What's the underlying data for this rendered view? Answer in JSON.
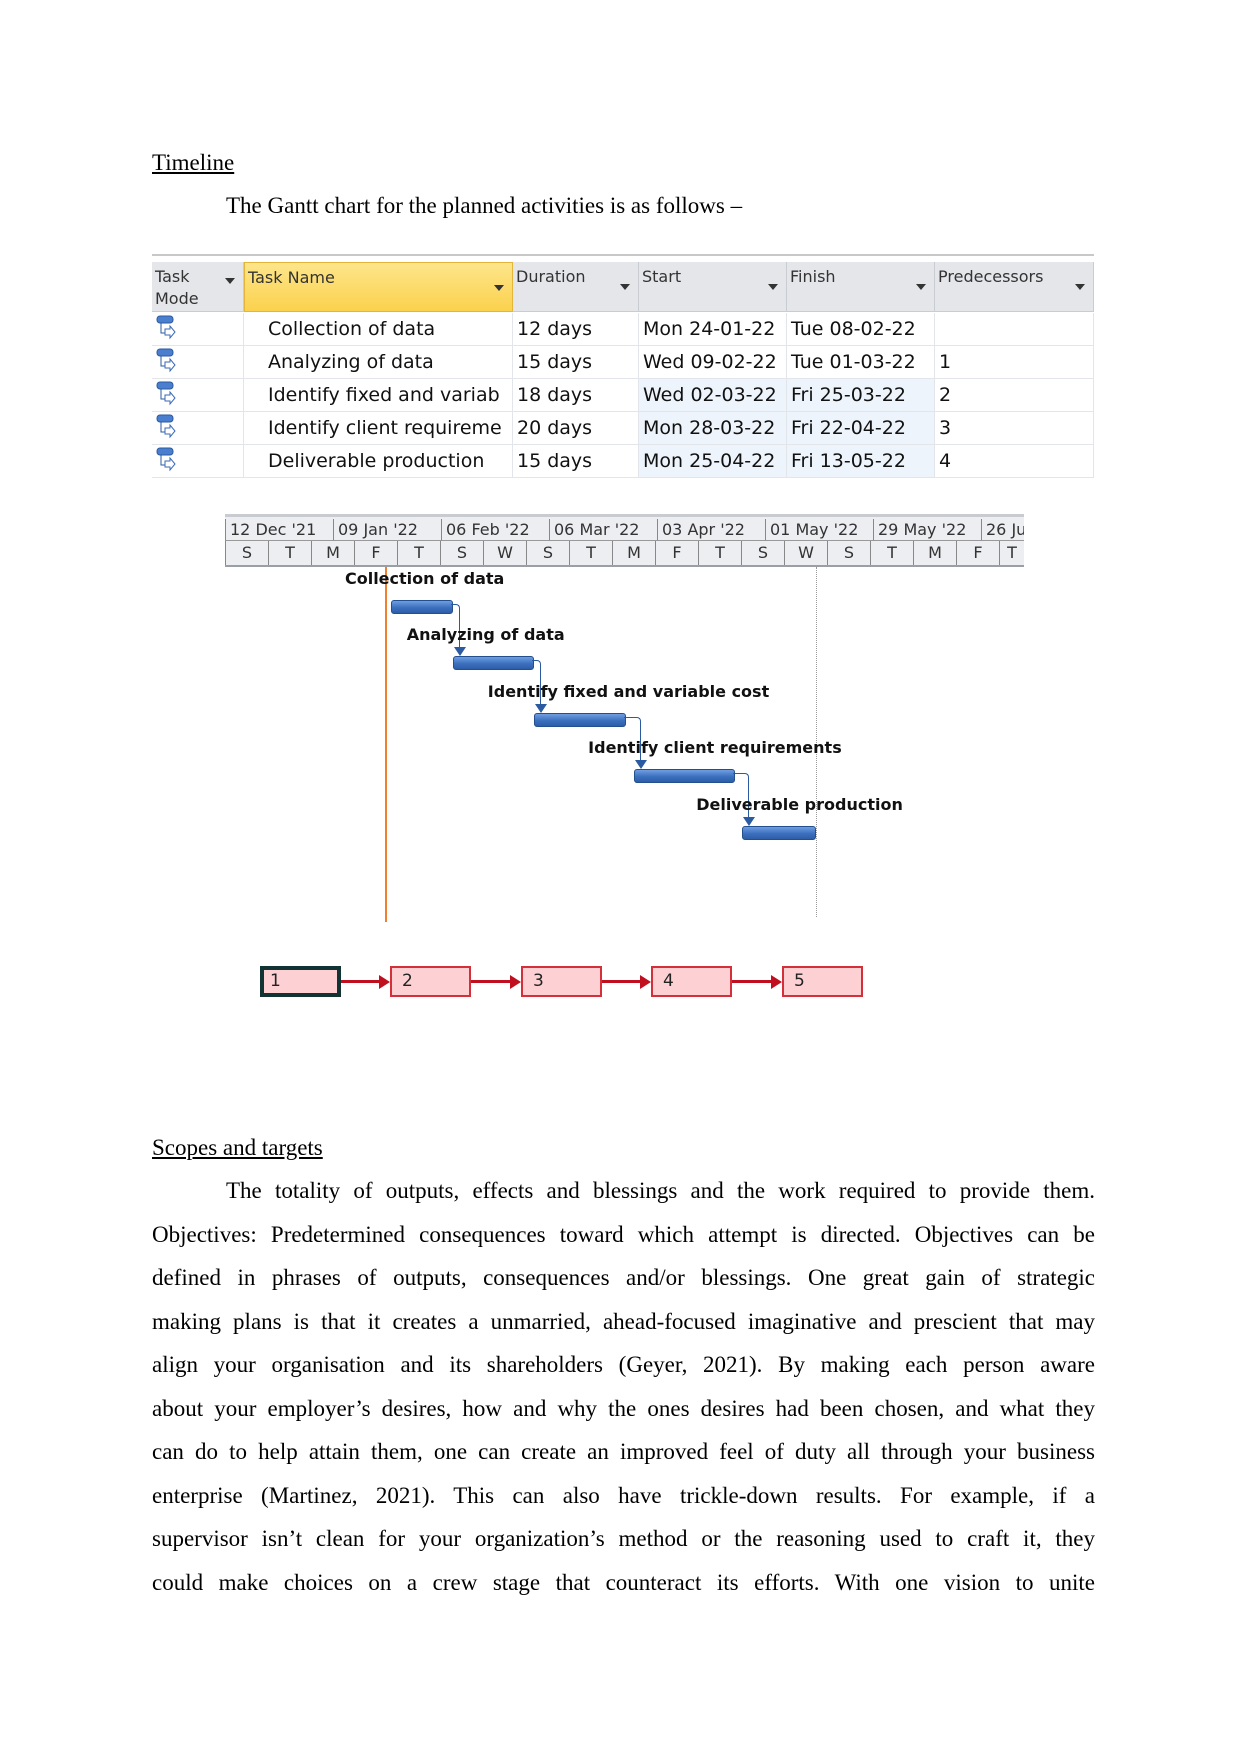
{
  "timeline": {
    "heading": "Timeline",
    "intro": "The Gantt chart for the planned activities is as follows –"
  },
  "table": {
    "headers": [
      "Task Mode",
      "Task Name",
      "Duration",
      "Start",
      "Finish",
      "Predecessors"
    ],
    "header_mode_lines": [
      "Task",
      "Mode"
    ],
    "task_mode_icon": "auto-scheduled-task-icon",
    "rows": [
      {
        "name": "Collection of data",
        "duration": "12 days",
        "start": "Mon 24-01-22",
        "finish": "Tue 08-02-22",
        "pred": ""
      },
      {
        "name": "Analyzing of data",
        "duration": "15 days",
        "start": "Wed 09-02-22",
        "finish": "Tue 01-03-22",
        "pred": "1"
      },
      {
        "name": "Identify fixed and variab",
        "duration": "18 days",
        "start": "Wed 02-03-22",
        "finish": "Fri 25-03-22",
        "pred": "2"
      },
      {
        "name": "Identify client requireme",
        "duration": "20 days",
        "start": "Mon 28-03-22",
        "finish": "Fri 22-04-22",
        "pred": "3"
      },
      {
        "name": "Deliverable production",
        "duration": "15 days",
        "start": "Mon 25-04-22",
        "finish": "Fri 13-05-22",
        "pred": "4"
      }
    ]
  },
  "gantt": {
    "major_scale": [
      "12 Dec '21",
      "09 Jan '22",
      "06 Feb '22",
      "06 Mar '22",
      "03 Apr '22",
      "01 May '22",
      "29 May '22",
      "26 Ju"
    ],
    "minor_scale": [
      "S",
      "T",
      "M",
      "F",
      "T",
      "S",
      "W",
      "S",
      "T",
      "M",
      "F",
      "T",
      "S",
      "W",
      "S",
      "T",
      "M",
      "F",
      "T"
    ],
    "bar_labels": [
      "Collection of data",
      "Analyzing of data",
      "Identify fixed and variable cost",
      "Identify client requirements",
      "Deliverable production"
    ],
    "colors": {
      "bar": "#3b70c0",
      "status_line": "#f08030",
      "network_box": "#fdd0d3",
      "network_border": "#d4303a"
    }
  },
  "network": {
    "nodes": [
      "1",
      "2",
      "3",
      "4",
      "5"
    ]
  },
  "scopes": {
    "heading": "Scopes and targets",
    "lines": [
      "The totality of outputs, effects and blessings and the work required to provide them.",
      "Objectives: Predetermined consequences toward which attempt is directed. Objectives can be",
      "defined in phrases of outputs, consequences and/or blessings. One great gain of strategic",
      "making plans is that it creates a unmarried, ahead-focused imaginative and prescient that may",
      "align your organisation and its shareholders (Geyer, 2021). By making each person aware",
      "about your employer’s desires, how and why the ones desires had been chosen, and what they",
      "can do to help attain them, one can create an improved feel of duty all through your business",
      "enterprise (Martinez, 2021). This can also have trickle-down results. For example, if a",
      "supervisor isn’t clean for your organization’s method or the reasoning used to craft it, they",
      "could make choices on a crew stage that counteract its efforts. With one vision to unite"
    ]
  }
}
